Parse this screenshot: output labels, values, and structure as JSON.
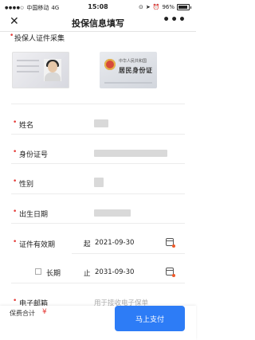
{
  "status_bar": {
    "carrier": "中国移动",
    "network": "4G",
    "time": "15:08",
    "battery": "96%"
  },
  "nav": {
    "close_glyph": "✕",
    "title": "投保信息填写",
    "more_glyph": "•••"
  },
  "id_section": {
    "title": "投保人证件采集",
    "back_card_line1": "中华人民共和国",
    "back_card_line2": "居民身份证"
  },
  "form": {
    "required_mark": "•",
    "name_label": "姓名",
    "id_label": "身份证号",
    "gender_label": "性别",
    "birth_label": "出生日期",
    "validity_label": "证件有效期",
    "start_prefix": "起",
    "start_date": "2021-09-30",
    "long_term_label": "长期",
    "end_prefix": "止",
    "end_date": "2031-09-30",
    "email_label": "电子邮箱",
    "email_placeholder": "用于接收电子保单"
  },
  "footer": {
    "total_label": "保费合计",
    "currency": "¥",
    "pay_button": "马上支付"
  },
  "colors": {
    "accent": "#2d7cf6",
    "required": "#e53935"
  }
}
